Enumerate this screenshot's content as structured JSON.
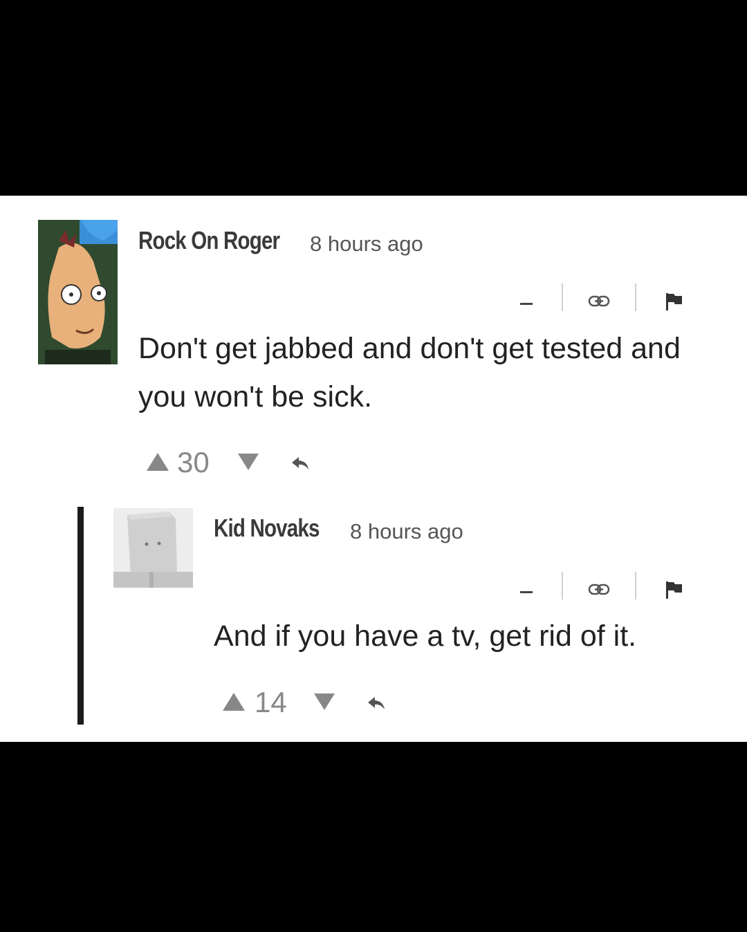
{
  "comments": [
    {
      "author": "Rock On Roger",
      "time": "8 hours ago",
      "text": "Don't get jabbed and don't get tested and you won't be sick.",
      "votes": "30",
      "avatar": "cartoon-character-avatar"
    },
    {
      "author": "Kid Novaks",
      "time": "8 hours ago",
      "text": "And if you have a tv, get rid of it.",
      "votes": "14",
      "avatar": "paper-bag-head-avatar"
    }
  ],
  "icons": {
    "collapse": "minus-icon",
    "link": "link-icon",
    "flag": "flag-icon",
    "upvote": "upvote-triangle-icon",
    "downvote": "downvote-triangle-icon",
    "reply": "reply-arrow-icon"
  },
  "colors": {
    "frame": "#000000",
    "panel": "#ffffff",
    "author": "#3a3a3a",
    "body": "#222222",
    "meta": "#555555",
    "votes": "#888888",
    "thread_bar": "#1b1b1b"
  }
}
